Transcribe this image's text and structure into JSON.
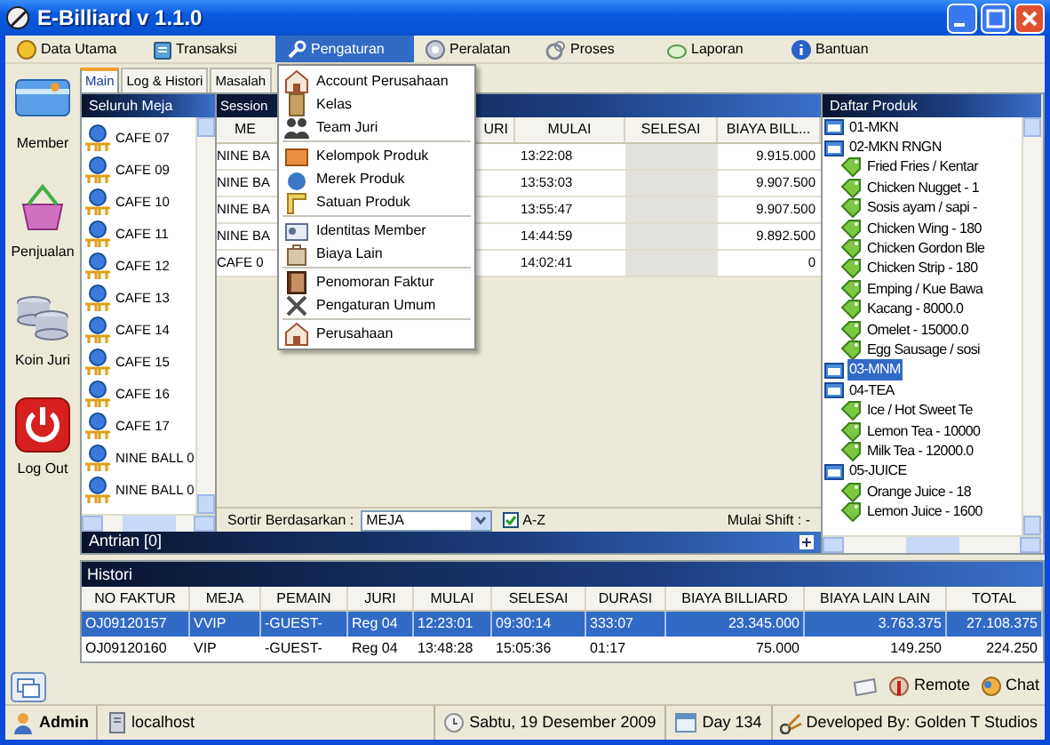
{
  "window": {
    "title": "E-Billiard v 1.1.0"
  },
  "menu_bar": [
    {
      "label": "Data Utama",
      "selected": false
    },
    {
      "label": "Transaksi",
      "selected": false
    },
    {
      "label": "Pengaturan",
      "selected": true
    },
    {
      "label": "Peralatan",
      "selected": false
    },
    {
      "label": "Proses",
      "selected": false
    },
    {
      "label": "Laporan",
      "selected": false
    },
    {
      "label": "Bantuan",
      "selected": false
    }
  ],
  "dropdown": {
    "groups": [
      [
        "Account Perusahaan",
        "Kelas",
        "Team Juri"
      ],
      [
        "Kelompok Produk",
        "Merek Produk",
        "Satuan Produk"
      ],
      [
        "Identitas Member",
        "Biaya Lain"
      ],
      [
        "Penomoran Faktur",
        "Pengaturan Umum"
      ],
      [
        "Perusahaan"
      ]
    ]
  },
  "sidebar": [
    {
      "label": "Member"
    },
    {
      "label": "Penjualan"
    },
    {
      "label": "Koin Juri"
    },
    {
      "label": "Log Out"
    }
  ],
  "tabs": [
    {
      "label": "Main",
      "selected": true
    },
    {
      "label": "Log & Histori",
      "selected": false
    },
    {
      "label": "Masalah",
      "selected": false
    }
  ],
  "tables_panel": {
    "title": "Seluruh Meja",
    "items": [
      "CAFE 07",
      "CAFE 09",
      "CAFE 10",
      "CAFE 11",
      "CAFE 12",
      "CAFE 13",
      "CAFE 14",
      "CAFE 15",
      "CAFE 16",
      "CAFE 17",
      "NINE BALL 0",
      "NINE BALL 0"
    ]
  },
  "session": {
    "title": "Session",
    "columns": [
      "ME",
      "URI",
      "MULAI",
      "SELESAI",
      "BIAYA BILL..."
    ],
    "rows": [
      {
        "column_1": "NINE BA",
        "mulai": "13:22:08",
        "biaya_billiard": "9.915.000"
      },
      {
        "column_1": "NINE BA",
        "mulai": "13:53:03",
        "biaya_billiard": "9.907.500"
      },
      {
        "column_1": "NINE BA",
        "mulai": "13:55:47",
        "biaya_billiard": "9.907.500"
      },
      {
        "column_1": "NINE BA",
        "mulai": "14:44:59",
        "biaya_billiard": "9.892.500"
      },
      {
        "column_1": "CAFE 0",
        "mulai": "14:02:41",
        "biaya_billiard": "0"
      }
    ]
  },
  "sort": {
    "label": "Sortir Berdasarkan :",
    "value": "MEJA",
    "az_label": "A-Z",
    "az_checked": true,
    "shift": "Mulai Shift : -"
  },
  "queue": {
    "title": "Antrian [0]"
  },
  "products": {
    "title": "Daftar Produk",
    "tree": [
      {
        "label": "01-MKN",
        "selected": false
      },
      {
        "label": "02-MKN RNGN",
        "selected": false,
        "children": [
          {
            "label": "Fried Fries / Kentar",
            "selected": false
          },
          {
            "label": "Chicken Nugget - 1",
            "selected": false
          },
          {
            "label": "Sosis ayam / sapi -",
            "selected": false
          },
          {
            "label": "Chicken Wing - 180",
            "selected": false
          },
          {
            "label": "Chicken Gordon Ble",
            "selected": false
          },
          {
            "label": "Chicken Strip - 180",
            "selected": false
          },
          {
            "label": "Emping / Kue Bawa",
            "selected": false
          },
          {
            "label": "Kacang - 8000.0",
            "selected": false
          },
          {
            "label": "Omelet - 15000.0",
            "selected": false
          },
          {
            "label": "Egg Sausage / sosi",
            "selected": false
          }
        ]
      },
      {
        "label": "03-MNM",
        "selected": true
      },
      {
        "label": "04-TEA",
        "selected": false,
        "children": [
          {
            "label": "Ice / Hot Sweet Te",
            "selected": false
          },
          {
            "label": "Lemon Tea - 10000",
            "selected": false
          },
          {
            "label": "Milk Tea - 12000.0",
            "selected": false
          }
        ]
      },
      {
        "label": "05-JUICE",
        "selected": false,
        "children": [
          {
            "label": "Orange Juice  - 18",
            "selected": false
          },
          {
            "label": "Lemon Juice - 1600",
            "selected": false
          }
        ]
      }
    ]
  },
  "history": {
    "title": "Histori",
    "columns": [
      "NO FAKTUR",
      "MEJA",
      "PEMAIN",
      "JURI",
      "MULAI",
      "SELESAI",
      "DURASI",
      "BIAYA BILLIARD",
      "BIAYA LAIN LAIN",
      "TOTAL"
    ],
    "rows": [
      {
        "selected": true,
        "cells": [
          "OJ09120157",
          "VVIP",
          "-GUEST-",
          "Reg 04",
          "12:23:01",
          "09:30:14",
          "333:07",
          "23.345.000",
          "3.763.375",
          "27.108.375"
        ]
      },
      {
        "selected": false,
        "cells": [
          "OJ09120160",
          "VIP",
          "-GUEST-",
          "Reg 04",
          "13:48:28",
          "15:05:36",
          "01:17",
          "75.000",
          "149.250",
          "224.250"
        ]
      }
    ]
  },
  "footer": {
    "remote": "Remote",
    "chat": "Chat"
  },
  "status_bar": {
    "user": "Admin",
    "host": "localhost",
    "date": "Sabtu, 19 Desember 2009",
    "day": "Day 134",
    "developer": "Developed By: Golden T Studios"
  }
}
